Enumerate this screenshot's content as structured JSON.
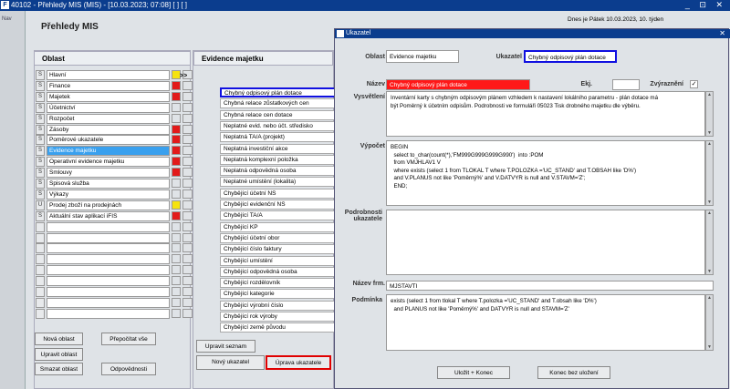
{
  "window": {
    "title": "40102 - Přehledy MIS (MIS) - [10.03.2023; 07:08] [ ] [ ]",
    "controls": "_ ⊡ ✕"
  },
  "sidebar": {
    "label": "Nav"
  },
  "header": {
    "title": "Přehledy MIS",
    "date": "Dnes je Pátek  10.03.2023, 10. týden"
  },
  "oblast": {
    "title": "Oblast",
    "items": [
      {
        "flag": "S",
        "label": "Hlavní",
        "color": "#f5e30f"
      },
      {
        "flag": "S",
        "label": "Finance",
        "color": "#e21a1a"
      },
      {
        "flag": "S",
        "label": "Majetek",
        "color": "#e21a1a"
      },
      {
        "flag": "S",
        "label": "Účetnictví",
        "color": ""
      },
      {
        "flag": "S",
        "label": "Rozpočet",
        "color": ""
      },
      {
        "flag": "S",
        "label": "Zásoby",
        "color": "#e21a1a"
      },
      {
        "flag": "S",
        "label": "Poměrové ukazatele",
        "color": "#e21a1a"
      },
      {
        "flag": "S",
        "label": "Evidence majetku",
        "color": "#e21a1a"
      },
      {
        "flag": "S",
        "label": "Operativní evidence majetku",
        "color": "#e21a1a"
      },
      {
        "flag": "S",
        "label": "Smlouvy",
        "color": "#e21a1a"
      },
      {
        "flag": "S",
        "label": "Spisová služba",
        "color": ""
      },
      {
        "flag": "S",
        "label": "Výkazy",
        "color": ""
      },
      {
        "flag": "U",
        "label": "Prodej zboží na prodejnách",
        "color": "#f5e30f"
      },
      {
        "flag": "S",
        "label": "Aktuální stav aplikací iFIS",
        "color": "#e21a1a"
      },
      {
        "flag": "",
        "label": "",
        "color": ""
      },
      {
        "flag": "",
        "label": "",
        "color": ""
      },
      {
        "flag": "",
        "label": "",
        "color": ""
      },
      {
        "flag": "",
        "label": "",
        "color": ""
      },
      {
        "flag": "",
        "label": "",
        "color": ""
      },
      {
        "flag": "",
        "label": "",
        "color": ""
      },
      {
        "flag": "",
        "label": "",
        "color": ""
      },
      {
        "flag": "",
        "label": "",
        "color": ""
      },
      {
        "flag": "",
        "label": "",
        "color": ""
      }
    ],
    "arrow": ">>",
    "buttons": {
      "nova": "Nová oblast",
      "prepocitat": "Přepočítat vše",
      "upravit": "Upravit oblast",
      "smazat": "Smazat oblast",
      "odpovednosti": "Odpovědnosti"
    }
  },
  "evidence": {
    "title": "Evidence majetku",
    "items": [
      "Chybný odpisový plán dotace",
      "Chybná relace zůstatkových cen",
      "Chybná relace cen dotace",
      "Neplatné evid. nebo účt. středisko",
      "Neplatná TA/A (projekt)",
      "Neplatná investiční akce",
      "Neplatná komplexní položka",
      "Neplatná odpovědná osoba",
      "Neplatné umístění (lokalita)",
      "Chybějící účetní NS",
      "Chybějící evidenční NS",
      "Chybějící TA/A",
      "Chybějící KP",
      "Chybějící účetní obor",
      "Chybějící číslo faktury",
      "Chybějící umístění",
      "Chybějící odpovědná osoba",
      "Chybějící rozdělovník",
      "Chybějící kategorie",
      "Chybějící výrobní číslo",
      "Chybějící rok výroby",
      "Chybějící země původu"
    ],
    "buttons": {
      "upravit_seznam": "Upravit seznam",
      "novy": "Nový ukazatel",
      "uprava": "Úprava ukazatele"
    }
  },
  "dialog": {
    "title": "Ukazatel",
    "oblast_label": "Oblast",
    "oblast_value": "Evidence majetku",
    "ukazatel_label": "Ukazatel",
    "ukazatel_value": "Chybný odpisový plán dotace",
    "nazev_label": "Název",
    "nazev_value": "Chybný odpisový plán dotace",
    "ekj_label": "Ekj.",
    "ekj_value": "",
    "zvyrazneni_label": "Zvýraznění",
    "zvyrazneni_check": "✓",
    "vysvetleni_label": "Vysvětlení",
    "vysvetleni_value": "Inventární karty s chybným odpisovým plánem vzhledem k nastavení lokálního parametru - plán dotace má\nbýt Poměrný k účetním odpisům. Podrobnosti ve formuláři 05023 Tisk drobného majetku dle výběru.",
    "vypocet_label": "Výpočet",
    "vypocet_value": "BEGIN\n  select to_char(count(*),'FM999G999G999G990')  into :POM\n  from VMJHLAV1 V\n  where exists (select 1 from TLOKAL T where T.POLOZKA ='UC_STAND' and T.OBSAH like 'D%')\n  and V.PLANUS not like 'Poměrný%' and V.DATVYR is null and V.STAVM='Z';\n  END;",
    "podrobnosti_label": "Podrobnosti\nukazatele",
    "podrobnosti_value": "",
    "nazevfrm_label": "Název frm.",
    "nazevfrm_value": "MJSTAVTI",
    "podminka_label": "Podmínka",
    "podminka_value": "exists (select 1 from tlokal T where T.polozka ='UC_STAND' and T.obsah like 'D%')\n  and PLANUS not like 'Poměrný%' and DATVYR is null and STAVM='Z'",
    "ulozit": "Uložit + Konec",
    "konec": "Konec bez uložení"
  }
}
